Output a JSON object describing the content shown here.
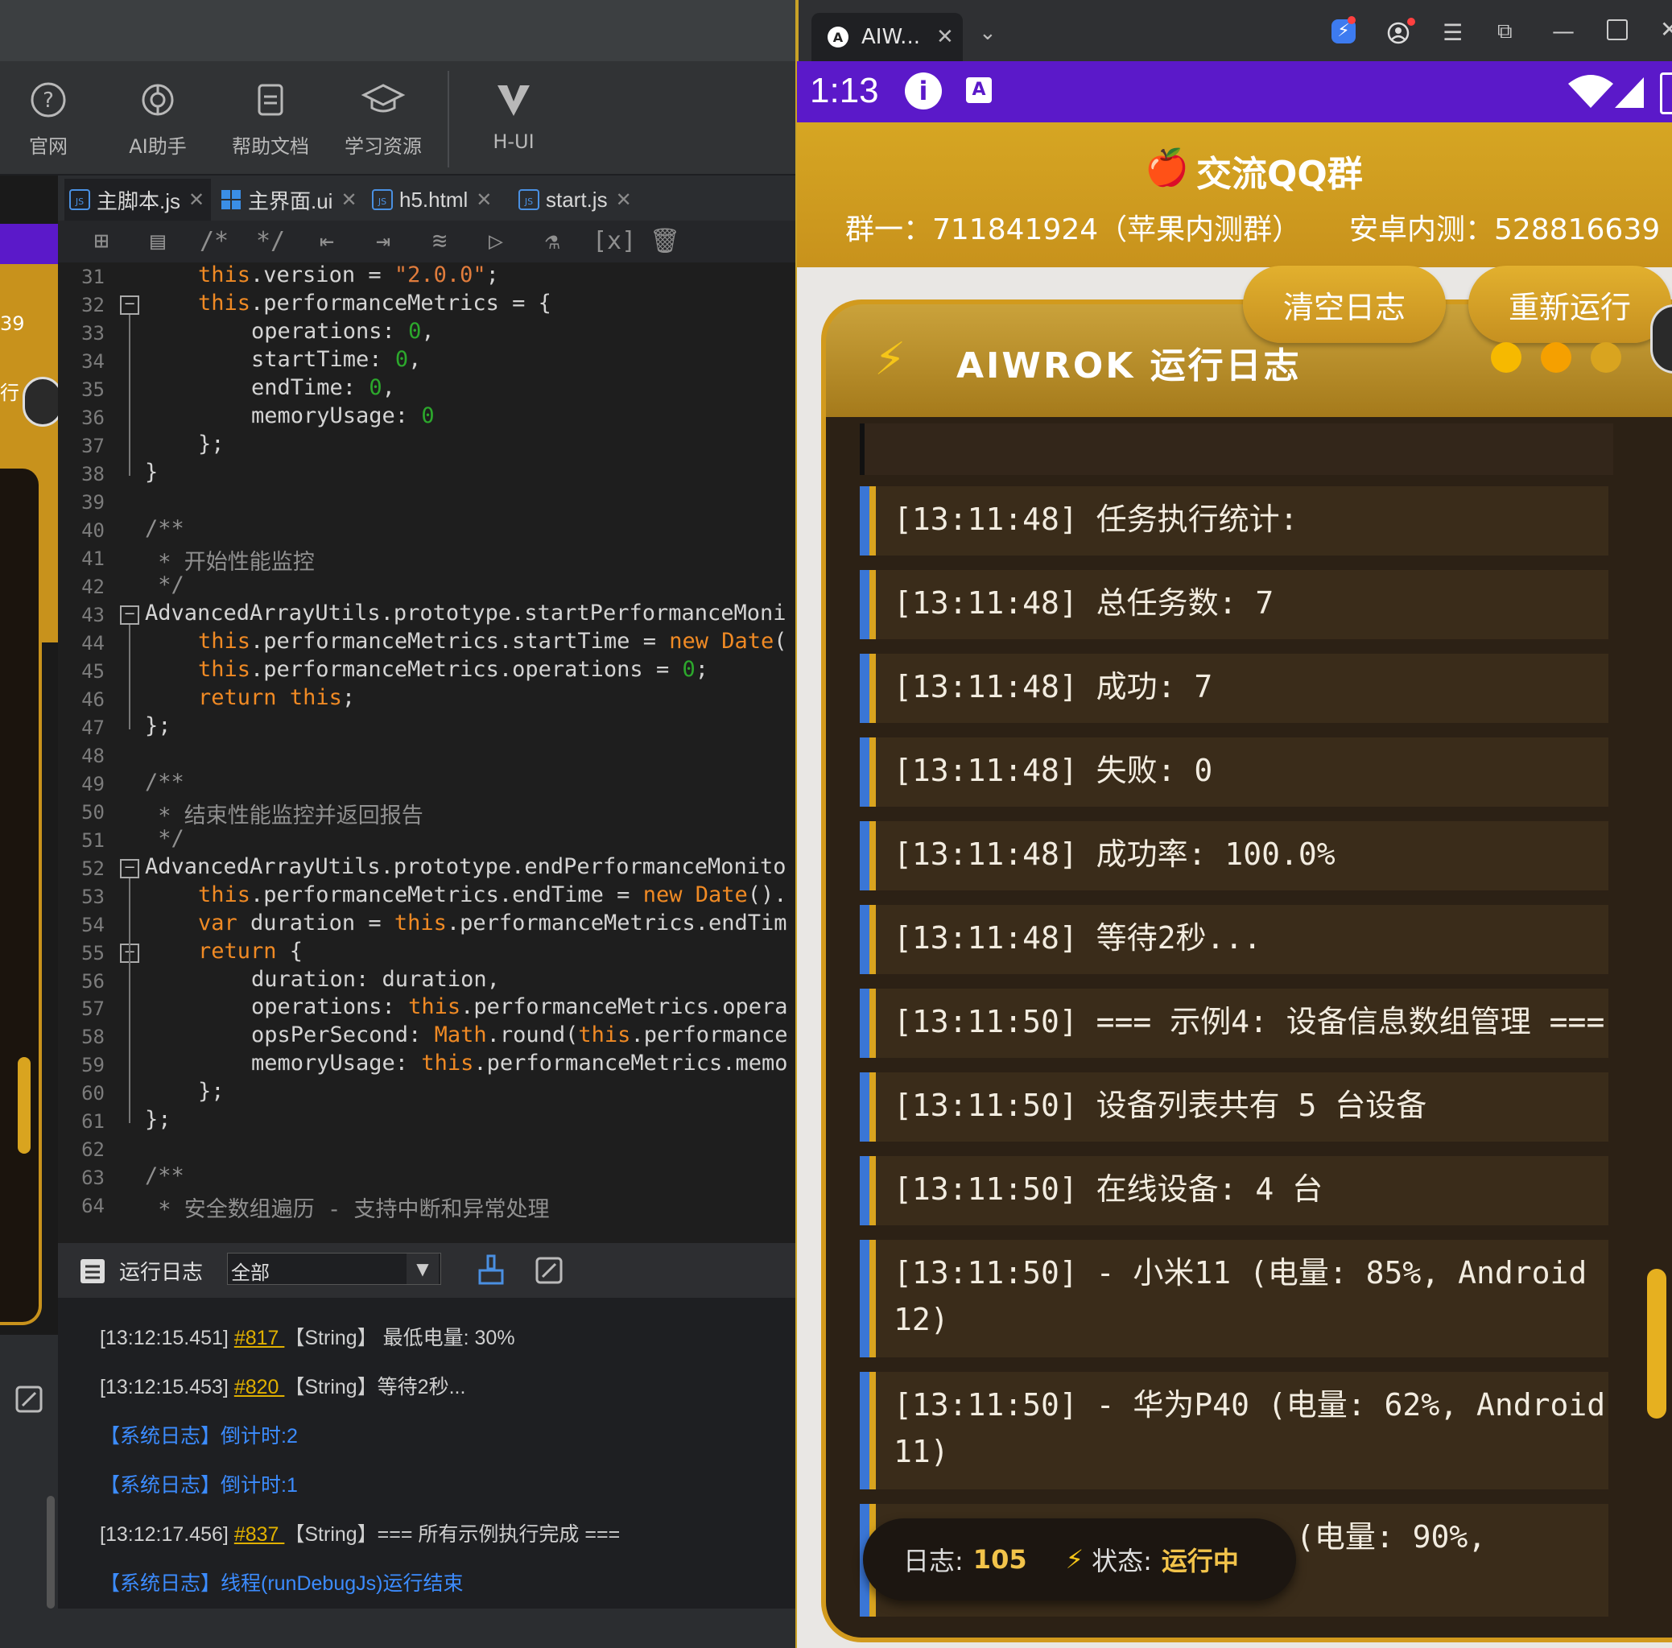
{
  "ide": {
    "toolbar": [
      {
        "label": "官网",
        "icon": "help-circle-icon"
      },
      {
        "label": "AI助手",
        "icon": "ai-assistant-icon"
      },
      {
        "label": "帮助文档",
        "icon": "document-icon"
      },
      {
        "label": "学习资源",
        "icon": "graduation-cap-icon"
      },
      {
        "label": "H-UI",
        "icon": "h-ui-logo-icon"
      }
    ],
    "tabs": [
      {
        "label": "主脚本.js",
        "icon": "js-file-icon"
      },
      {
        "label": "主界面.ui",
        "icon": "ui-file-icon"
      },
      {
        "label": "h5.html",
        "icon": "js-file-icon"
      },
      {
        "label": "start.js",
        "icon": "js-file-icon"
      }
    ],
    "side_labels": {
      "num": "39",
      "char": "行"
    },
    "code_lines": [
      {
        "n": "31",
        "html": "<span class='kw'>this</span>.version = <span class='str'>\"2.0.0\"</span>;",
        "indent": 1
      },
      {
        "n": "32",
        "html": "<span class='kw'>this</span>.performanceMetrics = {",
        "indent": 1
      },
      {
        "n": "33",
        "html": "operations: <span class='num'>0</span>,",
        "indent": 2
      },
      {
        "n": "34",
        "html": "startTime: <span class='num'>0</span>,",
        "indent": 2
      },
      {
        "n": "35",
        "html": "endTime: <span class='num'>0</span>,",
        "indent": 2
      },
      {
        "n": "36",
        "html": "memoryUsage: <span class='num'>0</span>",
        "indent": 2
      },
      {
        "n": "37",
        "html": "};",
        "indent": 1
      },
      {
        "n": "38",
        "html": "}",
        "indent": 0
      },
      {
        "n": "39",
        "html": "",
        "indent": 0
      },
      {
        "n": "40",
        "html": "<span class='cm'>/**</span>",
        "indent": 0
      },
      {
        "n": "41",
        "html": "<span class='cm'> * 开始性能监控</span>",
        "indent": 0
      },
      {
        "n": "42",
        "html": "<span class='cm'> */</span>",
        "indent": 0
      },
      {
        "n": "43",
        "html": "AdvancedArrayUtils.prototype.startPerformanceMoni",
        "indent": 0
      },
      {
        "n": "44",
        "html": "<span class='kw'>this</span>.performanceMetrics.startTime = <span class='kw'>new</span> <span class='kw'>Date</span>(",
        "indent": 1
      },
      {
        "n": "45",
        "html": "<span class='kw'>this</span>.performanceMetrics.operations = <span class='num'>0</span>;",
        "indent": 1
      },
      {
        "n": "46",
        "html": "<span class='kw'>return</span> <span class='kw'>this</span>;",
        "indent": 1
      },
      {
        "n": "47",
        "html": "};",
        "indent": 0
      },
      {
        "n": "48",
        "html": "",
        "indent": 0
      },
      {
        "n": "49",
        "html": "<span class='cm'>/**</span>",
        "indent": 0
      },
      {
        "n": "50",
        "html": "<span class='cm'> * 结束性能监控并返回报告</span>",
        "indent": 0
      },
      {
        "n": "51",
        "html": "<span class='cm'> */</span>",
        "indent": 0
      },
      {
        "n": "52",
        "html": "AdvancedArrayUtils.prototype.endPerformanceMonito",
        "indent": 0
      },
      {
        "n": "53",
        "html": "<span class='kw'>this</span>.performanceMetrics.endTime = <span class='kw'>new</span> <span class='kw'>Date</span>().",
        "indent": 1
      },
      {
        "n": "54",
        "html": "<span class='kw'>var</span> duration = <span class='kw'>this</span>.performanceMetrics.endTim",
        "indent": 1
      },
      {
        "n": "55",
        "html": "<span class='kw'>return</span> {",
        "indent": 1
      },
      {
        "n": "56",
        "html": "duration: duration,",
        "indent": 2
      },
      {
        "n": "57",
        "html": "operations: <span class='kw'>this</span>.performanceMetrics.opera",
        "indent": 2
      },
      {
        "n": "58",
        "html": "opsPerSecond: <span class='kw'>Math</span>.round(<span class='kw'>this</span>.performance",
        "indent": 2
      },
      {
        "n": "59",
        "html": "memoryUsage: <span class='kw'>this</span>.performanceMetrics.memo",
        "indent": 2
      },
      {
        "n": "60",
        "html": "};",
        "indent": 1
      },
      {
        "n": "61",
        "html": "};",
        "indent": 0
      },
      {
        "n": "62",
        "html": "",
        "indent": 0
      },
      {
        "n": "63",
        "html": "<span class='cm'>/**</span>",
        "indent": 0
      },
      {
        "n": "64",
        "html": "<span class='cm'> * 安全数组遍历 - 支持中断和异常处理</span>",
        "indent": 0
      }
    ],
    "log_panel": {
      "title": "运行日志",
      "filter": "全部"
    },
    "log_lines": [
      {
        "pre": "[13:12:15.451] ",
        "id": "#817 ",
        "post": "【String】 最低电量: 30%",
        "sys": false
      },
      {
        "pre": "[13:12:15.453] ",
        "id": "#820 ",
        "post": "【String】等待2秒...",
        "sys": false
      },
      {
        "pre": "【系统日志】倒计时:2",
        "id": "",
        "post": "",
        "sys": true
      },
      {
        "pre": "【系统日志】倒计时:1",
        "id": "",
        "post": "",
        "sys": true
      },
      {
        "pre": "[13:12:17.456] ",
        "id": "#837 ",
        "post": "【String】=== 所有示例执行完成 ===",
        "sys": false
      },
      {
        "pre": "【系统日志】线程(runDebugJs)运行结束",
        "id": "",
        "post": "",
        "sys": true
      }
    ]
  },
  "emulator": {
    "window_tab": "AIW...",
    "status_time": "1:13",
    "header": {
      "title": "交流QQ群",
      "group1": "群一：711841924（苹果内测群）",
      "android": "安卓内测：528816639"
    },
    "buttons": {
      "clear": "清空日志",
      "rerun": "重新运行"
    },
    "card_title": "AIWROK 运行日志",
    "entries": [
      "[13:11:48] 任务执行统计:",
      "[13:11:48] 总任务数: 7",
      "[13:11:48] 成功: 7",
      "[13:11:48] 失败: 0",
      "[13:11:48] 成功率: 100.0%",
      "[13:11:48] 等待2秒...",
      "[13:11:50] === 示例4: 设备信息数组管理 ===",
      "[13:11:50] 设备列表共有 5 台设备",
      "[13:11:50] 在线设备: 4 台",
      "[13:11:50] - 小米11 (电量: 85%, Android 12)",
      "[13:11:50] - 华为P40 (电量: 62%, Android 11)",
      "(电量: 90%,"
    ],
    "footer": {
      "log_label": "日志:",
      "log_count": "105",
      "status_label": "状态:",
      "status_value": "运行中"
    },
    "colors": {
      "accent_gold": "#d4a021",
      "status_purple": "#5b19c9",
      "log_blue": "#3a76d6",
      "log_bg": "#2c2115"
    }
  }
}
